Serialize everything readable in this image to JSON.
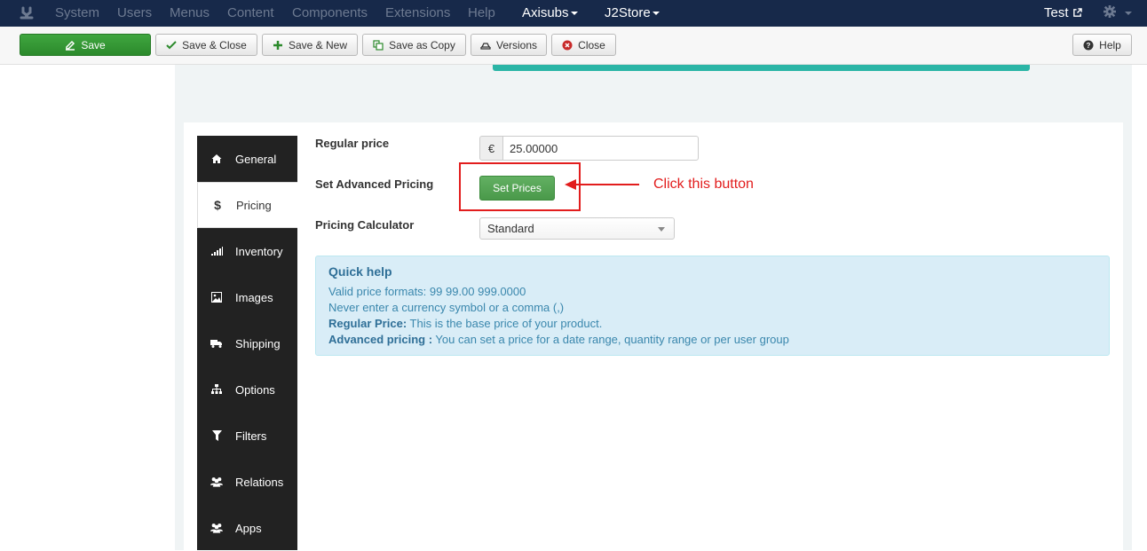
{
  "navbar": {
    "items": [
      "System",
      "Users",
      "Menus",
      "Content",
      "Components",
      "Extensions",
      "Help"
    ],
    "site_menu": "Axisubs",
    "component_menu": "J2Store",
    "user": "Test"
  },
  "toolbar": {
    "save": "Save",
    "save_close": "Save & Close",
    "save_new": "Save & New",
    "save_copy": "Save as Copy",
    "versions": "Versions",
    "close": "Close",
    "help": "Help"
  },
  "tabs": [
    {
      "label": "General",
      "icon": "home-icon"
    },
    {
      "label": "Pricing",
      "icon": "dollar-icon"
    },
    {
      "label": "Inventory",
      "icon": "signal-icon"
    },
    {
      "label": "Images",
      "icon": "image-icon"
    },
    {
      "label": "Shipping",
      "icon": "truck-icon"
    },
    {
      "label": "Options",
      "icon": "sitemap-icon"
    },
    {
      "label": "Filters",
      "icon": "filter-icon"
    },
    {
      "label": "Relations",
      "icon": "users-icon"
    },
    {
      "label": "Apps",
      "icon": "users-icon"
    }
  ],
  "pricing": {
    "regular_price_label": "Regular price",
    "currency_symbol": "€",
    "regular_price_value": "25.00000",
    "advanced_label": "Set Advanced Pricing",
    "set_prices_button": "Set Prices",
    "calculator_label": "Pricing Calculator",
    "calculator_value": "Standard"
  },
  "annotation": {
    "text": "Click this button",
    "color": "#e21d1d"
  },
  "quick_help": {
    "title": "Quick help",
    "line1": "Valid price formats: 99 99.00 999.0000",
    "line2": "Never enter a currency symbol or a comma (,)",
    "line3_bold": "Regular Price:",
    "line3_text": " This is the base price of your product.",
    "line4_bold": "Advanced pricing :",
    "line4_text": " You can set a price for a date range, quantity range or per user group"
  },
  "colors": {
    "navbar": "#17294a",
    "save_green": "#2c8a2c",
    "teal": "#2bb5a6",
    "help_bg": "#d9edf7"
  }
}
